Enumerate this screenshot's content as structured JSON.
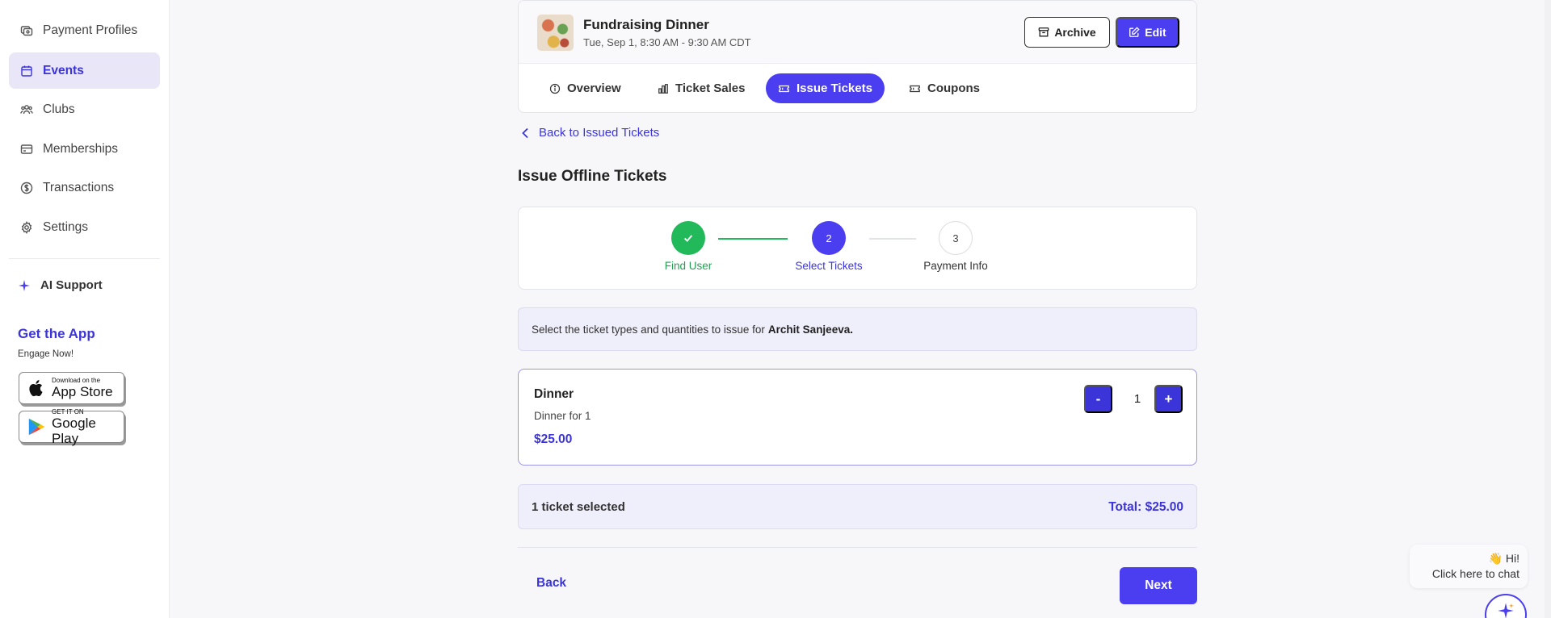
{
  "sidebar": {
    "items": [
      {
        "label": "Payment Profiles",
        "icon": "payment-profiles-icon"
      },
      {
        "label": "Events",
        "icon": "calendar-icon",
        "active": true
      },
      {
        "label": "Clubs",
        "icon": "users-icon"
      },
      {
        "label": "Memberships",
        "icon": "card-icon"
      },
      {
        "label": "Transactions",
        "icon": "dollar-icon"
      },
      {
        "label": "Settings",
        "icon": "gear-icon"
      }
    ],
    "ai_support": "AI Support",
    "get_app_title": "Get the App",
    "engage": "Engage Now!",
    "app_store": {
      "small": "Download on the",
      "big": "App Store"
    },
    "google_play": {
      "small": "GET IT ON",
      "big": "Google Play"
    }
  },
  "event": {
    "title": "Fundraising Dinner",
    "date": "Tue, Sep 1, 8:30 AM - 9:30 AM CDT",
    "archive_label": "Archive",
    "edit_label": "Edit"
  },
  "tabs": [
    {
      "label": "Overview"
    },
    {
      "label": "Ticket Sales"
    },
    {
      "label": "Issue Tickets",
      "active": true
    },
    {
      "label": "Coupons"
    }
  ],
  "back_link": "Back to Issued Tickets",
  "page_title": "Issue Offline Tickets",
  "steps": [
    {
      "number": "1",
      "label": "Find User",
      "state": "done"
    },
    {
      "number": "2",
      "label": "Select Tickets",
      "state": "current"
    },
    {
      "number": "3",
      "label": "Payment Info",
      "state": "pending"
    }
  ],
  "info": {
    "text": "Select the ticket types and quantities to issue for",
    "user": "Archit Sanjeeva."
  },
  "ticket": {
    "name": "Dinner",
    "description": "Dinner for 1",
    "price": "$25.00",
    "minus": "-",
    "quantity": "1",
    "plus": "+"
  },
  "summary": {
    "selected": "1 ticket selected",
    "total": "Total: $25.00"
  },
  "footer": {
    "back_label": "Back",
    "next_label": "Next"
  },
  "chat": {
    "line1": "👋 Hi!",
    "line2": "Click here to chat"
  },
  "colors": {
    "accent": "#4a3ef0",
    "success": "#22b95a",
    "active_nav_bg": "#e8e6f7"
  }
}
